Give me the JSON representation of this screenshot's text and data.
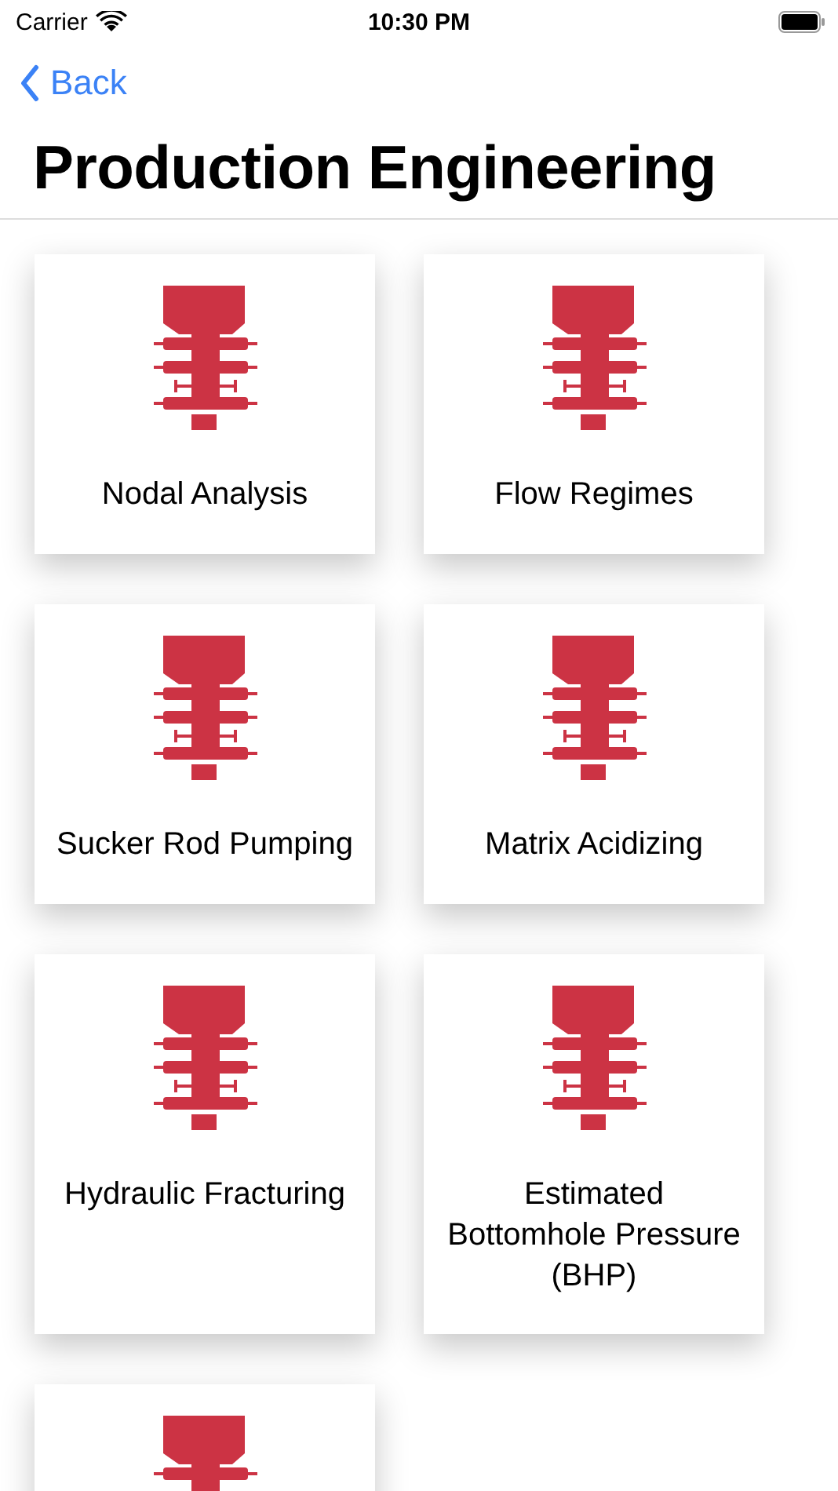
{
  "status_bar": {
    "carrier": "Carrier",
    "time": "10:30 PM"
  },
  "nav": {
    "back_label": "Back",
    "title": "Production Engineering"
  },
  "tiles": [
    {
      "kind": "labelled",
      "label": "Nodal Analysis"
    },
    {
      "kind": "labelled",
      "label": "Flow Regimes"
    },
    {
      "kind": "labelled",
      "label": "Sucker Rod Pumping"
    },
    {
      "kind": "labelled",
      "label": "Matrix Acidizing"
    },
    {
      "kind": "labelled",
      "label": "Hydraulic Fracturing"
    },
    {
      "kind": "labelled",
      "label": "Estimated Bottomhole Pressure (BHP)"
    },
    {
      "kind": "icon_only"
    }
  ]
}
